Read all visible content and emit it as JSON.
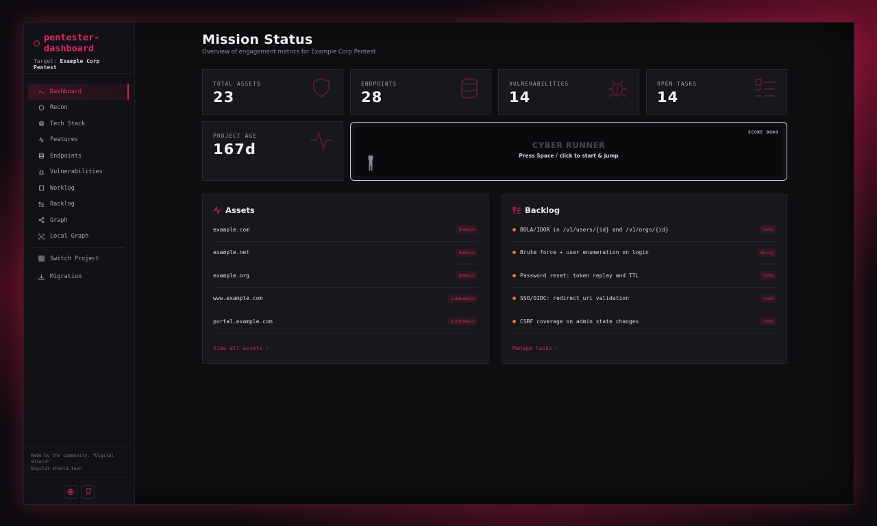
{
  "app": {
    "name": "pentester-dashboard",
    "name_line1": "pentester-",
    "name_line2": "dashboard",
    "target_label": "Target:",
    "target_value": "Example Corp Pentest",
    "accent_color": "#d2245a"
  },
  "sidebar": {
    "items": [
      {
        "label": "Dashboard",
        "icon": "terminal-icon",
        "active": true
      },
      {
        "label": "Recon",
        "icon": "shield-icon"
      },
      {
        "label": "Tech Stack",
        "icon": "cpu-icon"
      },
      {
        "label": "Features",
        "icon": "activity-icon"
      },
      {
        "label": "Endpoints",
        "icon": "database-icon"
      },
      {
        "label": "Vulnerabilities",
        "icon": "bug-icon"
      },
      {
        "label": "Worklog",
        "icon": "notebook-icon"
      },
      {
        "label": "Backlog",
        "icon": "list-todo-icon"
      },
      {
        "label": "Graph",
        "icon": "share-icon"
      },
      {
        "label": "Local Graph",
        "icon": "scan-icon"
      },
      {
        "label": "Switch Project",
        "icon": "grid-icon"
      },
      {
        "label": "Migration",
        "icon": "download-icon"
      }
    ],
    "credit_line1": "Made by the community: \"Digital",
    "credit_line2": "Shield\"",
    "credit_line3": "Digital-shield.tech",
    "footer_icons": [
      "globe-icon",
      "github-icon"
    ]
  },
  "header": {
    "title": "Mission Status",
    "subtitle": "Overview of engagement metrics for Example Corp Pentest"
  },
  "stats": {
    "total_assets": {
      "label": "TOTAL ASSETS",
      "value": "23",
      "icon": "shield-icon"
    },
    "endpoints": {
      "label": "ENDPOINTS",
      "value": "28",
      "icon": "database-icon"
    },
    "vulnerabilities": {
      "label": "VULNERABILITIES",
      "value": "14",
      "icon": "bug-icon"
    },
    "open_tasks": {
      "label": "OPEN TASKS",
      "value": "14",
      "icon": "list-todo-icon"
    },
    "project_age": {
      "label": "PROJECT AGE",
      "value": "167d",
      "icon": "activity-icon"
    }
  },
  "game": {
    "score": "SCORE 0000",
    "title": "CYBER RUNNER",
    "hint": "Press Space / click to start & jump"
  },
  "assets": {
    "title": "Assets",
    "rows": [
      {
        "name": "example.com",
        "tag": "domain"
      },
      {
        "name": "example.net",
        "tag": "domain"
      },
      {
        "name": "example.org",
        "tag": "domain"
      },
      {
        "name": "www.example.com",
        "tag": "subdomain"
      },
      {
        "name": "portal.example.com",
        "tag": "subdomain"
      }
    ],
    "link": "View all assets"
  },
  "backlog": {
    "title": "Backlog",
    "rows": [
      {
        "name": "BOLA/IDOR in /v1/users/{id} and /v1/orgs/{id}",
        "tag": "todo"
      },
      {
        "name": "Brute force + user enumeration on login",
        "tag": "doing"
      },
      {
        "name": "Password reset: token replay and TTL",
        "tag": "todo"
      },
      {
        "name": "SSO/OIDC: redirect_uri validation",
        "tag": "todo"
      },
      {
        "name": "CSRF coverage on admin state changes",
        "tag": "todo"
      }
    ],
    "link": "Manage tasks"
  }
}
